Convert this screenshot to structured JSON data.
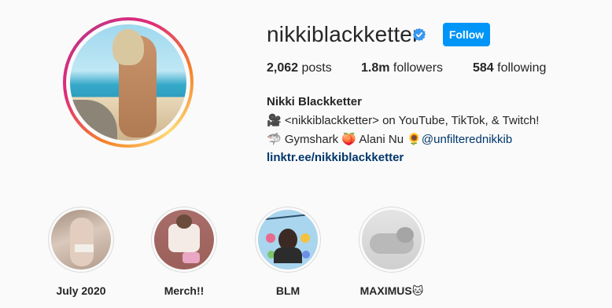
{
  "profile": {
    "username": "nikkiblackketter",
    "follow_label": "Follow",
    "full_name": "Nikki Blackketter",
    "stats": {
      "posts_count": "2,062",
      "posts_label": " posts",
      "followers_count": "1.8m",
      "followers_label": " followers",
      "following_count": "584",
      "following_label": " following"
    },
    "bio": {
      "line1": "🎥 <nikkiblackketter> on YouTube, TikTok, & Twitch!",
      "line2_text": "🦈 Gymshark 🍑 Alani Nu 🌻",
      "line2_mention": "@unfilterednikkib"
    },
    "link": "linktr.ee/nikkiblackketter"
  },
  "highlights": [
    {
      "label": "July 2020"
    },
    {
      "label": "Merch!!"
    },
    {
      "label": "BLM"
    },
    {
      "label": "MAXIMUS🐱"
    }
  ],
  "colors": {
    "follow_button": "#0095f6",
    "verified_badge": "#3897f0",
    "link": "#00376b"
  },
  "icons": {
    "verified": "verified-badge-icon"
  }
}
